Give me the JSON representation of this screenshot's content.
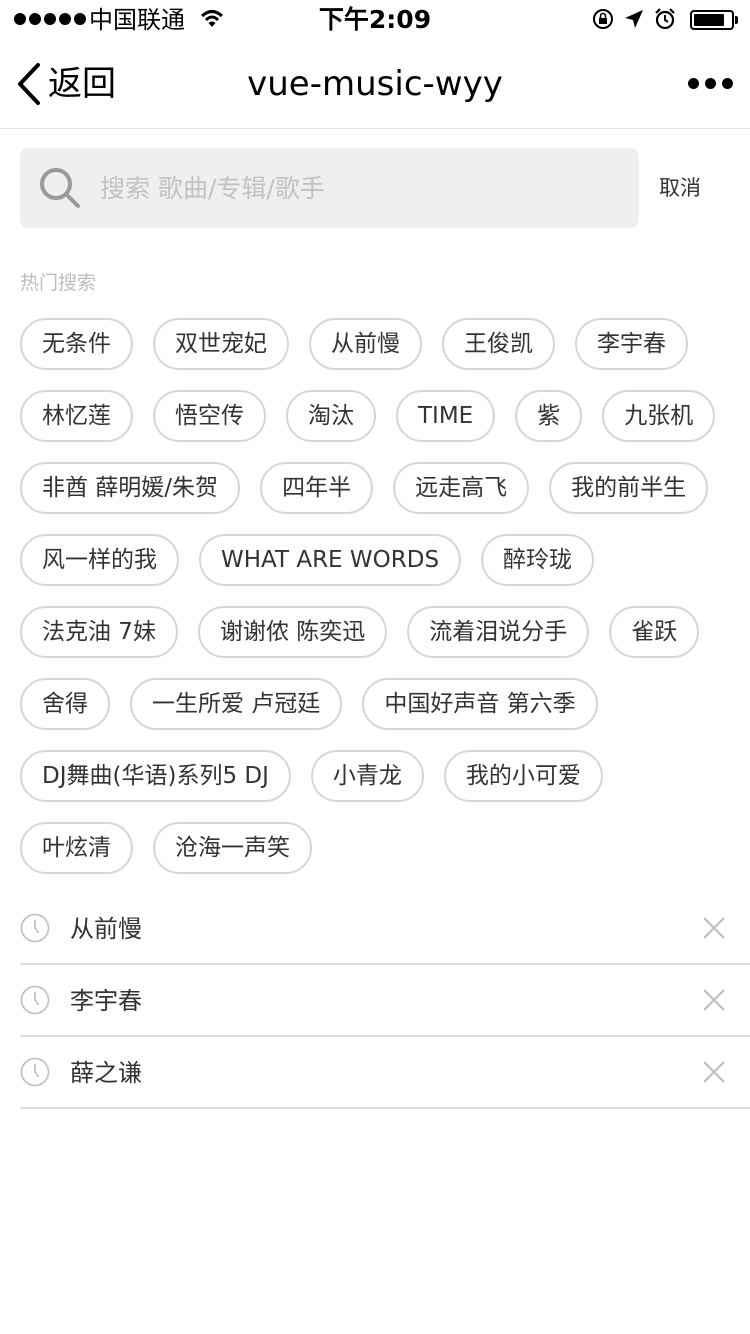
{
  "status_bar": {
    "carrier": "中国联通",
    "time": "下午2:09",
    "battery_level": 0.82
  },
  "nav": {
    "back_label": "返回",
    "title": "vue-music-wyy"
  },
  "search": {
    "placeholder": "搜索 歌曲/专辑/歌手",
    "value": "",
    "cancel_label": "取消"
  },
  "hot": {
    "title": "热门搜索",
    "items": [
      "无条件",
      "双世宠妃",
      "从前慢",
      "王俊凯",
      "李宇春",
      "林忆莲",
      "悟空传",
      "淘汰",
      "TIME",
      "紫",
      "九张机",
      "非酋 薛明媛/朱贺",
      "四年半",
      "远走高飞",
      "我的前半生",
      "风一样的我",
      "WHAT ARE WORDS",
      "醉玲珑",
      "法克油 7妹",
      "谢谢侬 陈奕迅",
      "流着泪说分手",
      "雀跃",
      "舍得",
      "一生所爱 卢冠廷",
      "中国好声音 第六季",
      "DJ舞曲(华语)系列5 DJ",
      "小青龙",
      "我的小可爱",
      "叶炫清",
      "沧海一声笑"
    ]
  },
  "history": {
    "items": [
      "从前慢",
      "李宇春",
      "薛之谦"
    ]
  },
  "icons": {
    "back": "chevron-left-icon",
    "more": "more-dots-icon",
    "search": "search-icon",
    "history": "clock-icon",
    "delete": "close-icon"
  },
  "colors": {
    "search_bg": "#efefef",
    "tag_border": "#d6d6d6",
    "muted_text": "#bdbdbd"
  }
}
